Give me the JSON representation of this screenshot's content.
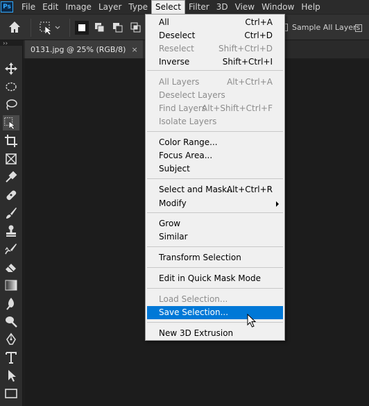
{
  "app": {
    "logo_text": "Ps"
  },
  "menubar": {
    "items": [
      "File",
      "Edit",
      "Image",
      "Layer",
      "Type",
      "Select",
      "Filter",
      "3D",
      "View",
      "Window",
      "Help"
    ],
    "active": "Select"
  },
  "options_bar": {
    "sample_all_layers_label": "Sample All Layers"
  },
  "document": {
    "tab_title": "0131.jpg @ 25% (RGB/8)",
    "close_glyph": "×"
  },
  "select_menu": {
    "all": {
      "label": "All",
      "shortcut": "Ctrl+A"
    },
    "deselect": {
      "label": "Deselect",
      "shortcut": "Ctrl+D"
    },
    "reselect": {
      "label": "Reselect",
      "shortcut": "Shift+Ctrl+D"
    },
    "inverse": {
      "label": "Inverse",
      "shortcut": "Shift+Ctrl+I"
    },
    "all_layers": {
      "label": "All Layers",
      "shortcut": "Alt+Ctrl+A"
    },
    "deselect_layers": {
      "label": "Deselect Layers"
    },
    "find_layers": {
      "label": "Find Layers",
      "shortcut": "Alt+Shift+Ctrl+F"
    },
    "isolate_layers": {
      "label": "Isolate Layers"
    },
    "color_range": {
      "label": "Color Range..."
    },
    "focus_area": {
      "label": "Focus Area..."
    },
    "subject": {
      "label": "Subject"
    },
    "select_and_mask": {
      "label": "Select and Mask...",
      "shortcut": "Alt+Ctrl+R"
    },
    "modify": {
      "label": "Modify"
    },
    "grow": {
      "label": "Grow"
    },
    "similar": {
      "label": "Similar"
    },
    "transform_selection": {
      "label": "Transform Selection"
    },
    "quick_mask": {
      "label": "Edit in Quick Mask Mode"
    },
    "load_selection": {
      "label": "Load Selection..."
    },
    "save_selection": {
      "label": "Save Selection..."
    },
    "new_3d_extrusion": {
      "label": "New 3D Extrusion"
    }
  },
  "colors": {
    "highlight": "#0078d7",
    "menu_bg": "#f0f0f0",
    "app_bg": "#1e1e1e"
  },
  "tools": [
    "move-icon",
    "marquee-icon",
    "lasso-icon",
    "object-selection-icon",
    "crop-icon",
    "frame-icon",
    "eyedropper-icon",
    "healing-brush-icon",
    "brush-icon",
    "stamp-icon",
    "history-brush-icon",
    "eraser-icon",
    "gradient-icon",
    "blur-icon",
    "dodge-icon",
    "pen-icon",
    "type-icon",
    "path-selection-icon",
    "rectangle-icon"
  ]
}
